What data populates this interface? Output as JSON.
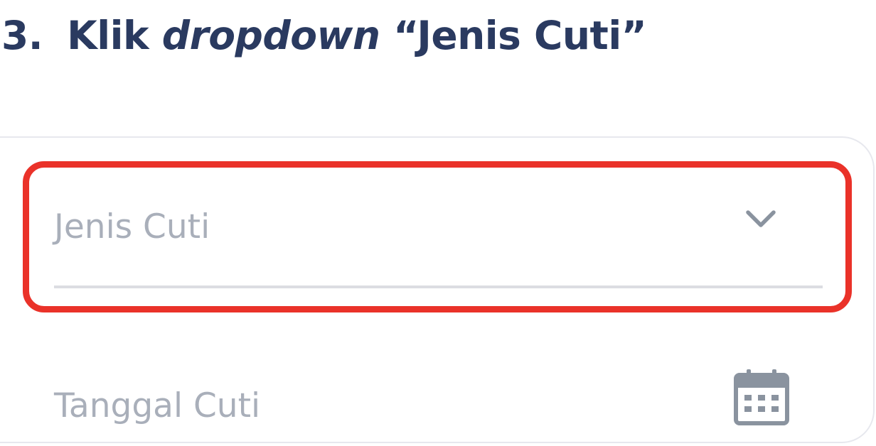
{
  "instruction": {
    "number": "3.",
    "prefix": "Klik",
    "emphasis": "dropdown",
    "suffix": "“Jenis Cuti”"
  },
  "form": {
    "leave_type": {
      "label": "Jenis Cuti",
      "icon": "chevron-down-icon"
    },
    "leave_date": {
      "label": "Tanggal Cuti",
      "icon": "calendar-icon"
    }
  },
  "colors": {
    "title": "#2a3a60",
    "highlight": "#ea3229",
    "placeholder": "#a9afba",
    "icon": "#8a939f",
    "divider": "#dcdde2",
    "card_border": "#e7e8ee"
  }
}
